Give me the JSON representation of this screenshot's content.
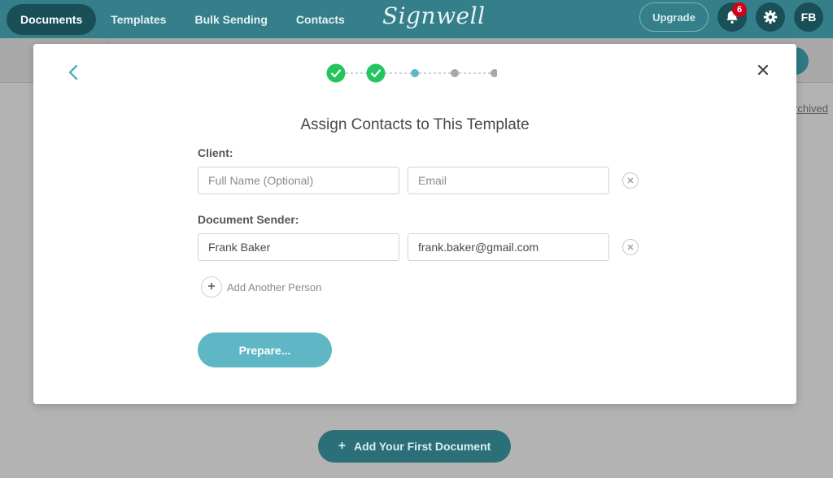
{
  "nav": {
    "items": [
      {
        "label": "Documents",
        "active": true
      },
      {
        "label": "Templates",
        "active": false
      },
      {
        "label": "Bulk Sending",
        "active": false
      },
      {
        "label": "Contacts",
        "active": false
      }
    ],
    "brand": "Signwell",
    "upgrade_label": "Upgrade",
    "notifications_count": "6",
    "avatar_initials": "FB"
  },
  "background": {
    "archived_link": "Archived",
    "add_document_label": "Add Your First Document"
  },
  "modal": {
    "title": "Assign Contacts to This Template",
    "stepper": {
      "total_steps": 5,
      "completed_steps": 2,
      "current_step": 3
    },
    "roles": [
      {
        "label": "Client:",
        "name_value": "",
        "name_placeholder": "Full Name (Optional)",
        "email_value": "",
        "email_placeholder": "Email"
      },
      {
        "label": "Document Sender:",
        "name_value": "Frank Baker",
        "name_placeholder": "Full Name (Optional)",
        "email_value": "frank.baker@gmail.com",
        "email_placeholder": "Email"
      }
    ],
    "add_person_label": "Add Another Person",
    "prepare_label": "Prepare..."
  },
  "colors": {
    "topbar": "#347f89",
    "nav_active": "#1b4f57",
    "step_done": "#22c55e",
    "step_current": "#5fb7c6",
    "step_pending": "#a8a8a8",
    "primary_button": "#5fb7c6",
    "notification_badge": "#d0021b"
  }
}
